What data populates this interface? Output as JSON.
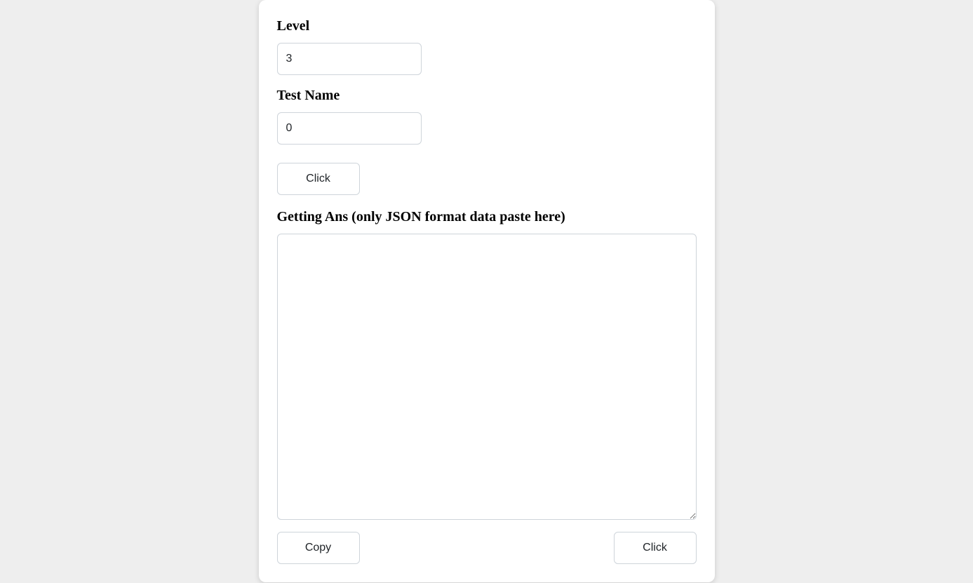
{
  "form": {
    "level_label": "Level",
    "level_value": "3",
    "testname_label": "Test Name",
    "testname_value": "0",
    "click_button_label": "Click",
    "ans_label": "Getting Ans (only JSON format data paste here)",
    "ans_value": "",
    "copy_button_label": "Copy",
    "bottom_click_button_label": "Click"
  }
}
